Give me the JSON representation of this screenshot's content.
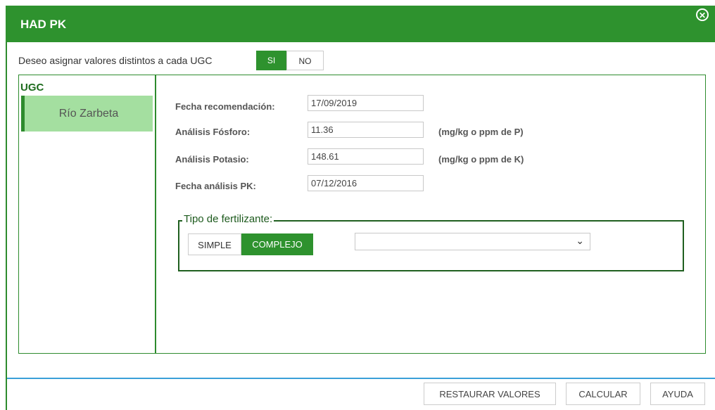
{
  "header": {
    "title": "HAD PK",
    "close_icon": "close-circle-icon"
  },
  "assign": {
    "label": "Deseo asignar valores distintos a cada UGC",
    "yes": "SI",
    "no": "NO",
    "selected": "SI"
  },
  "ugc": {
    "title": "UGC",
    "items": [
      {
        "label": "Río Zarbeta",
        "selected": true
      }
    ]
  },
  "form": {
    "fecha_recomendacion": {
      "label": "Fecha recomendación:",
      "value": "17/09/2019"
    },
    "fosforo": {
      "label": "Análisis Fósforo:",
      "value": "11.36",
      "unit": "(mg/kg o ppm de P)"
    },
    "potasio": {
      "label": "Análisis Potasio:",
      "value": "148.61",
      "unit": "(mg/kg o ppm de K)"
    },
    "fecha_analisis": {
      "label": "Fecha análisis PK:",
      "value": "07/12/2016"
    }
  },
  "fertilizante": {
    "legend": "Tipo de fertilizante:",
    "simple": "SIMPLE",
    "complejo": "COMPLEJO",
    "selected": "COMPLEJO",
    "select_value": ""
  },
  "footer": {
    "restore": "RESTAURAR VALORES",
    "calculate": "CALCULAR",
    "help": "AYUDA"
  },
  "colors": {
    "primary_green": "#2e922e",
    "selected_item": "#a4dfa0",
    "footer_line": "#3aa0d8"
  }
}
